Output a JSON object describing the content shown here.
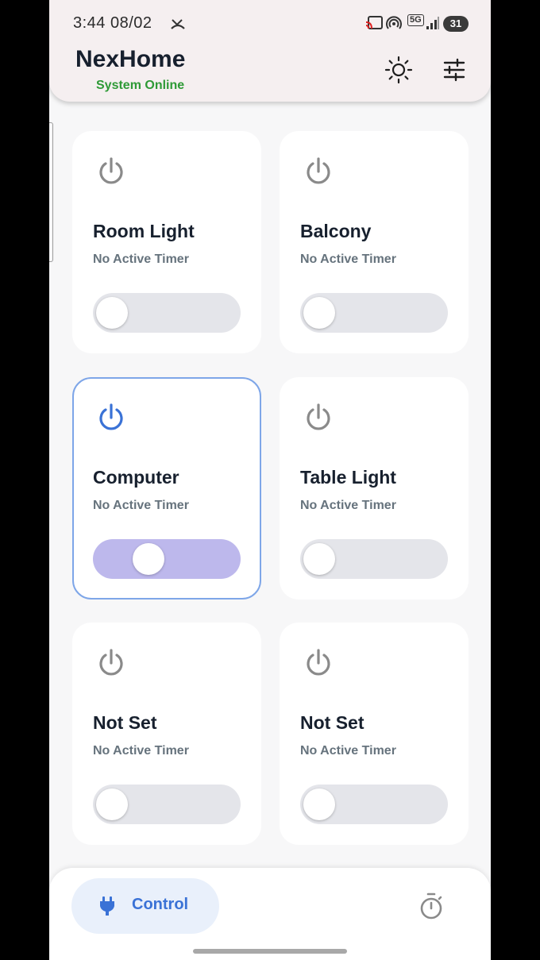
{
  "status_bar": {
    "time": "3:44",
    "date": "08/02",
    "network": "5G",
    "battery": "31"
  },
  "header": {
    "title": "NexHome",
    "status": "System Online"
  },
  "devices": [
    {
      "name": "Room Light",
      "timer": "No Active Timer",
      "on": false
    },
    {
      "name": "Balcony",
      "timer": "No Active Timer",
      "on": false
    },
    {
      "name": "Computer",
      "timer": "No Active Timer",
      "on": true
    },
    {
      "name": "Table Light",
      "timer": "No Active Timer",
      "on": false
    },
    {
      "name": "Not Set",
      "timer": "No Active Timer",
      "on": false
    },
    {
      "name": "Not Set",
      "timer": "No Active Timer",
      "on": false
    }
  ],
  "bottom_nav": {
    "control_label": "Control",
    "control_icon": "plug-icon",
    "timer_icon": "stopwatch-icon"
  },
  "colors": {
    "accent": "#3a72d6",
    "online": "#2e9a36",
    "toggle_on_track": "#bdb8ec",
    "toggle_off_track": "#e4e5ea",
    "active_border": "#7ea6e8"
  }
}
